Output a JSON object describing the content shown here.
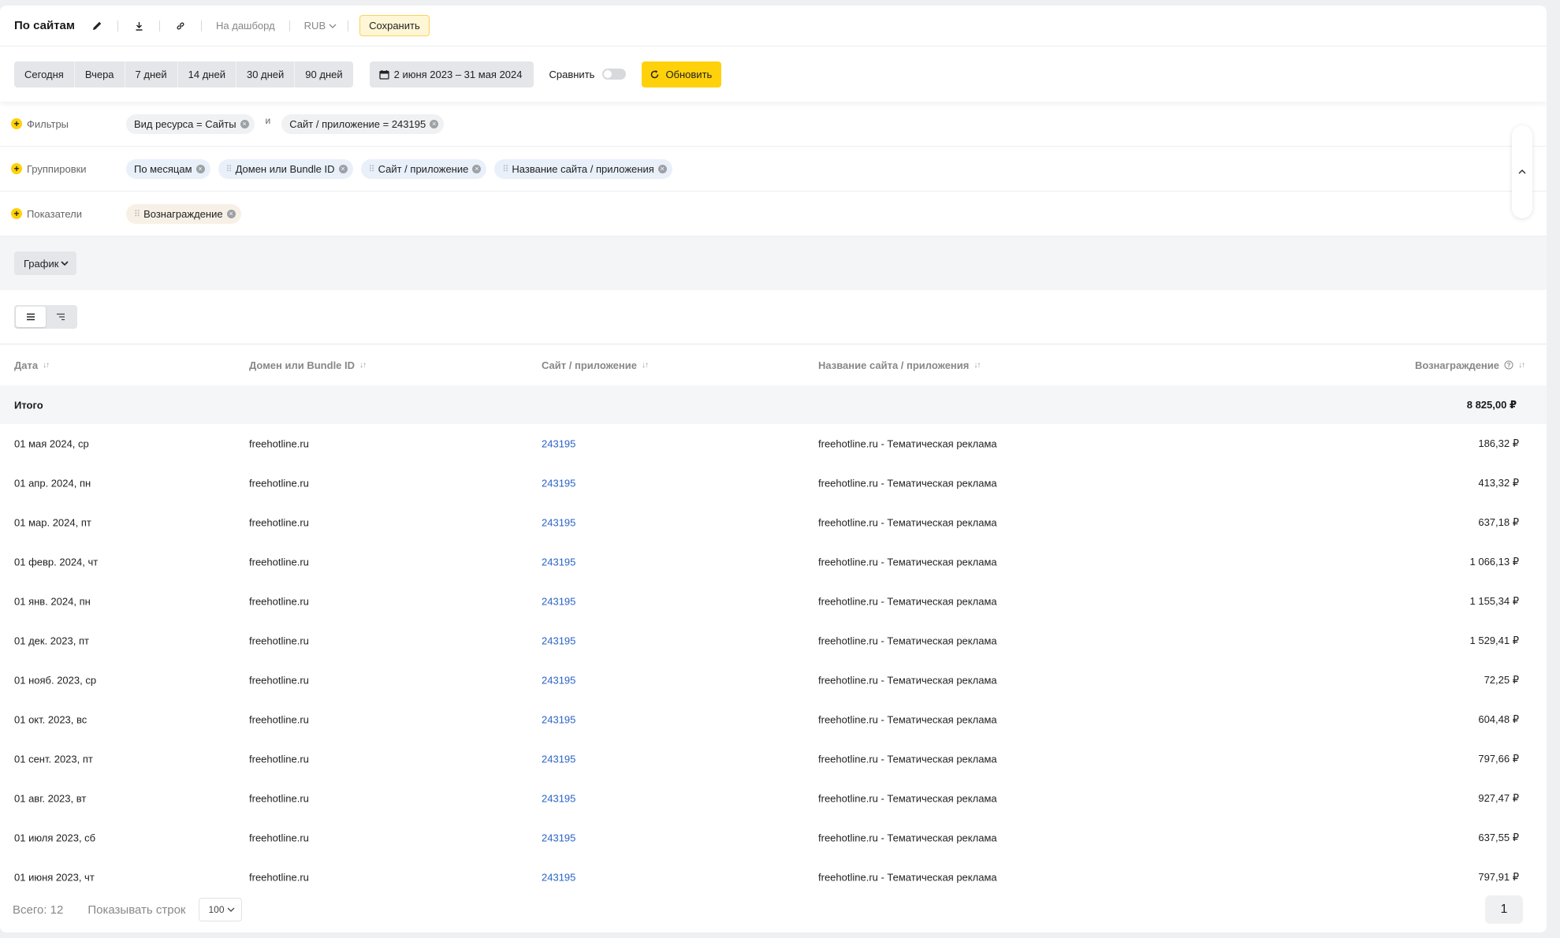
{
  "toolbar": {
    "title": "По сайтам",
    "dashboard_link": "На дашборд",
    "currency": "RUB",
    "save_label": "Сохранить"
  },
  "periods": [
    "Сегодня",
    "Вчера",
    "7 дней",
    "14 дней",
    "30 дней",
    "90 дней"
  ],
  "date_range": "2 июня 2023 – 31 мая 2024",
  "compare_label": "Сравнить",
  "refresh_label": "Обновить",
  "filters": {
    "label": "Фильтры",
    "chip1": "Вид ресурса = Сайты",
    "and_word": "и",
    "chip2": "Сайт / приложение = 243195"
  },
  "groupings": {
    "label": "Группировки",
    "chips": [
      "По месяцам",
      "Домен или Bundle ID",
      "Сайт / приложение",
      "Название сайта / приложения"
    ]
  },
  "metrics": {
    "label": "Показатели",
    "chips": [
      "Вознаграждение"
    ]
  },
  "chart_button": "График",
  "table": {
    "headers": {
      "date": "Дата",
      "domain": "Домен или Bundle ID",
      "site": "Сайт / приложение",
      "name": "Название сайта / приложения",
      "reward": "Вознаграждение"
    },
    "total": {
      "label": "Итого",
      "reward": "8 825,00 ₽"
    },
    "rows": [
      {
        "date": "01 мая 2024, ср",
        "domain": "freehotline.ru",
        "site": "243195",
        "name": "freehotline.ru - Тематическая реклама",
        "reward": "186,32 ₽"
      },
      {
        "date": "01 апр. 2024, пн",
        "domain": "freehotline.ru",
        "site": "243195",
        "name": "freehotline.ru - Тематическая реклама",
        "reward": "413,32 ₽"
      },
      {
        "date": "01 мар. 2024, пт",
        "domain": "freehotline.ru",
        "site": "243195",
        "name": "freehotline.ru - Тематическая реклама",
        "reward": "637,18 ₽"
      },
      {
        "date": "01 февр. 2024, чт",
        "domain": "freehotline.ru",
        "site": "243195",
        "name": "freehotline.ru - Тематическая реклама",
        "reward": "1 066,13 ₽"
      },
      {
        "date": "01 янв. 2024, пн",
        "domain": "freehotline.ru",
        "site": "243195",
        "name": "freehotline.ru - Тематическая реклама",
        "reward": "1 155,34 ₽"
      },
      {
        "date": "01 дек. 2023, пт",
        "domain": "freehotline.ru",
        "site": "243195",
        "name": "freehotline.ru - Тематическая реклама",
        "reward": "1 529,41 ₽"
      },
      {
        "date": "01 нояб. 2023, ср",
        "domain": "freehotline.ru",
        "site": "243195",
        "name": "freehotline.ru - Тематическая реклама",
        "reward": "72,25 ₽"
      },
      {
        "date": "01 окт. 2023, вс",
        "domain": "freehotline.ru",
        "site": "243195",
        "name": "freehotline.ru - Тематическая реклама",
        "reward": "604,48 ₽"
      },
      {
        "date": "01 сент. 2023, пт",
        "domain": "freehotline.ru",
        "site": "243195",
        "name": "freehotline.ru - Тематическая реклама",
        "reward": "797,66 ₽"
      },
      {
        "date": "01 авг. 2023, вт",
        "domain": "freehotline.ru",
        "site": "243195",
        "name": "freehotline.ru - Тематическая реклама",
        "reward": "927,47 ₽"
      },
      {
        "date": "01 июля 2023, сб",
        "domain": "freehotline.ru",
        "site": "243195",
        "name": "freehotline.ru - Тематическая реклама",
        "reward": "637,55 ₽"
      },
      {
        "date": "01 июня 2023, чт",
        "domain": "freehotline.ru",
        "site": "243195",
        "name": "freehotline.ru - Тематическая реклама",
        "reward": "797,91 ₽"
      }
    ]
  },
  "footer": {
    "total_count": "Всего: 12",
    "rows_label": "Показывать строк",
    "rows_value": "100",
    "page": "1"
  },
  "colors": {
    "accent_yellow": "#ffd10a",
    "link_blue": "#2a63c7"
  }
}
